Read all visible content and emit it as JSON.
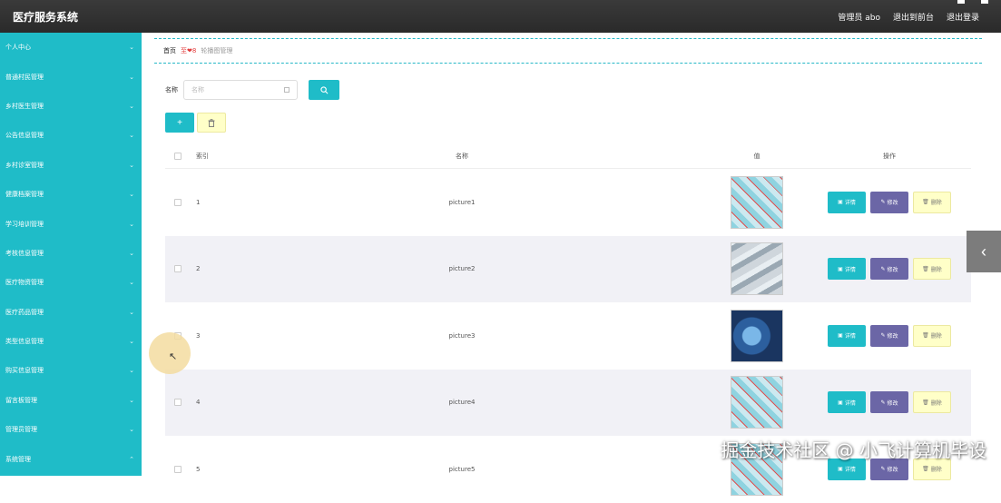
{
  "header": {
    "title": "医疗服务系统",
    "links": [
      "管理员 abo",
      "退出到前台",
      "退出登录"
    ]
  },
  "sidebar": {
    "items": [
      {
        "label": "个人中心"
      },
      {
        "label": "普通村民管理"
      },
      {
        "label": "乡村医生管理"
      },
      {
        "label": "公告信息管理"
      },
      {
        "label": "乡村诊室管理"
      },
      {
        "label": "健康档案管理"
      },
      {
        "label": "学习培训管理"
      },
      {
        "label": "考核信息管理"
      },
      {
        "label": "医疗物资管理"
      },
      {
        "label": "医疗药品管理"
      },
      {
        "label": "类型信息管理"
      },
      {
        "label": "购买信息管理"
      },
      {
        "label": "留言板管理"
      },
      {
        "label": "管理员管理"
      },
      {
        "label": "系统管理"
      }
    ]
  },
  "breadcrumb": {
    "home": "首页",
    "current": "至❤8",
    "last": "轮播图管理"
  },
  "search": {
    "label": "名称",
    "placeholder": "名称",
    "button_icon": "search-icon"
  },
  "actions": {
    "add_label": "+",
    "delete_icon": "trash-icon"
  },
  "table": {
    "headers": {
      "index": "索引",
      "name": "名称",
      "image": "值",
      "ops": "操作"
    },
    "rows": [
      {
        "index": "1",
        "name": "picture1"
      },
      {
        "index": "2",
        "name": "picture2"
      },
      {
        "index": "3",
        "name": "picture3"
      },
      {
        "index": "4",
        "name": "picture4"
      },
      {
        "index": "5",
        "name": "picture5"
      }
    ],
    "ops": {
      "detail": "详情",
      "edit": "修改",
      "delete": "删除"
    }
  },
  "watermark": "掘金技术社区 @ 小飞计算机毕设",
  "colors": {
    "accent": "#1fbcc8",
    "edit": "#6b66a6",
    "delete_bg": "#ffffc8",
    "topbar": "#2f2f2f",
    "breadcrumb_current": "#e23a3a"
  }
}
